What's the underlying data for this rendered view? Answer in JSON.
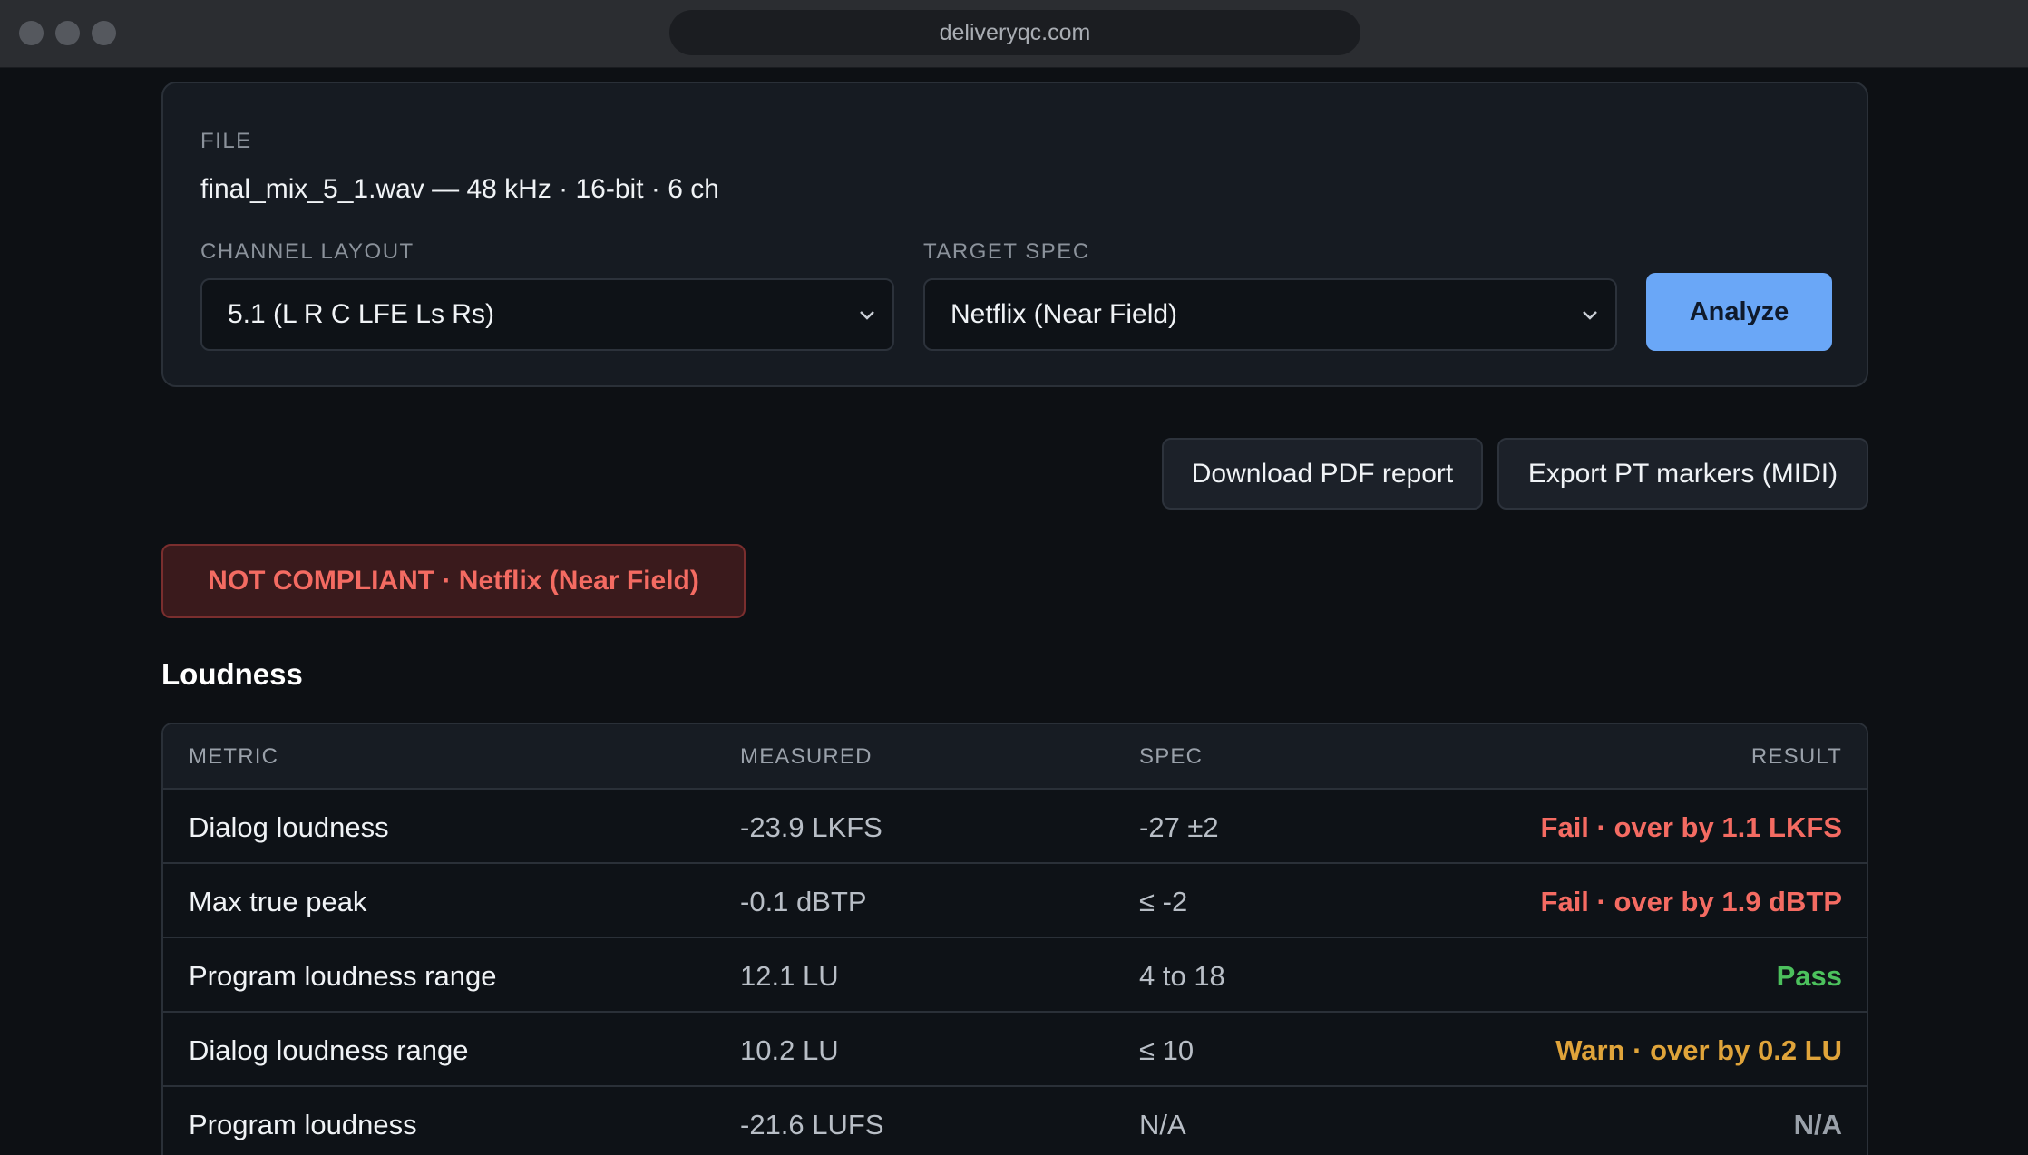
{
  "browser": {
    "url": "deliveryqc.com"
  },
  "file": {
    "label": "FILE",
    "info": "final_mix_5_1.wav — 48 kHz · 16-bit · 6 ch"
  },
  "channel_layout": {
    "label": "CHANNEL LAYOUT",
    "value": "5.1 (L R C LFE Ls Rs)"
  },
  "target_spec": {
    "label": "TARGET SPEC",
    "value": "Netflix (Near Field)"
  },
  "actions": {
    "analyze": "Analyze",
    "download_pdf": "Download PDF report",
    "export_markers": "Export PT markers (MIDI)"
  },
  "status": {
    "text": "NOT COMPLIANT · Netflix (Near Field)",
    "color": "#f46b62"
  },
  "loudness": {
    "title": "Loudness",
    "headers": {
      "metric": "METRIC",
      "measured": "MEASURED",
      "spec": "SPEC",
      "result": "RESULT"
    },
    "rows": [
      {
        "metric": "Dialog loudness",
        "measured": "-23.9 LKFS",
        "spec": "-27 ±2",
        "result": "Fail · over by 1.1 LKFS",
        "status": "fail"
      },
      {
        "metric": "Max true peak",
        "measured": "-0.1 dBTP",
        "spec": "≤ -2",
        "result": "Fail · over by 1.9 dBTP",
        "status": "fail"
      },
      {
        "metric": "Program loudness range",
        "measured": "12.1 LU",
        "spec": "4 to 18",
        "result": "Pass",
        "status": "pass"
      },
      {
        "metric": "Dialog loudness range",
        "measured": "10.2 LU",
        "spec": "≤ 10",
        "result": "Warn · over by 0.2 LU",
        "status": "warn"
      },
      {
        "metric": "Program loudness",
        "measured": "-21.6 LUFS",
        "spec": "N/A",
        "result": "N/A",
        "status": "na"
      }
    ]
  },
  "colors": {
    "fail": "#f46b62",
    "pass": "#4cc15d",
    "warn": "#e0a43a",
    "na": "#9aa1aa",
    "accent": "#6aa7f7"
  }
}
